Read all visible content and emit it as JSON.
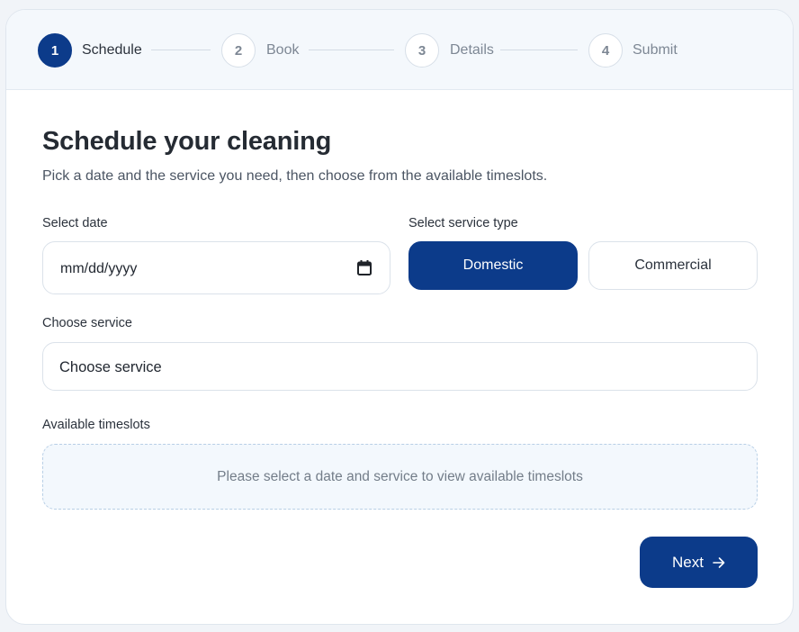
{
  "stepper": {
    "steps": [
      {
        "number": "1",
        "label": "Schedule",
        "active": true
      },
      {
        "number": "2",
        "label": "Book",
        "active": false
      },
      {
        "number": "3",
        "label": "Details",
        "active": false
      },
      {
        "number": "4",
        "label": "Submit",
        "active": false
      }
    ]
  },
  "page": {
    "title": "Schedule your cleaning",
    "subtitle": "Pick a date and the service you need, then choose from the available timeslots."
  },
  "date_field": {
    "label": "Select date",
    "value": "mm/dd/yyyy",
    "icon": "calendar-icon"
  },
  "service_type": {
    "label": "Select service type",
    "options": [
      {
        "label": "Domestic",
        "selected": true
      },
      {
        "label": "Commercial",
        "selected": false
      }
    ]
  },
  "service_select": {
    "label": "Choose service",
    "value": "Choose service"
  },
  "timeslots": {
    "label": "Available timeslots",
    "empty_message": "Please select a date and service to view available timeslots"
  },
  "actions": {
    "next_label": "Next",
    "next_icon": "arrow-right-icon"
  },
  "colors": {
    "primary": "#0c3b8a",
    "header_bg": "#f4f8fc",
    "timeslot_bg": "#f3f8fd"
  }
}
